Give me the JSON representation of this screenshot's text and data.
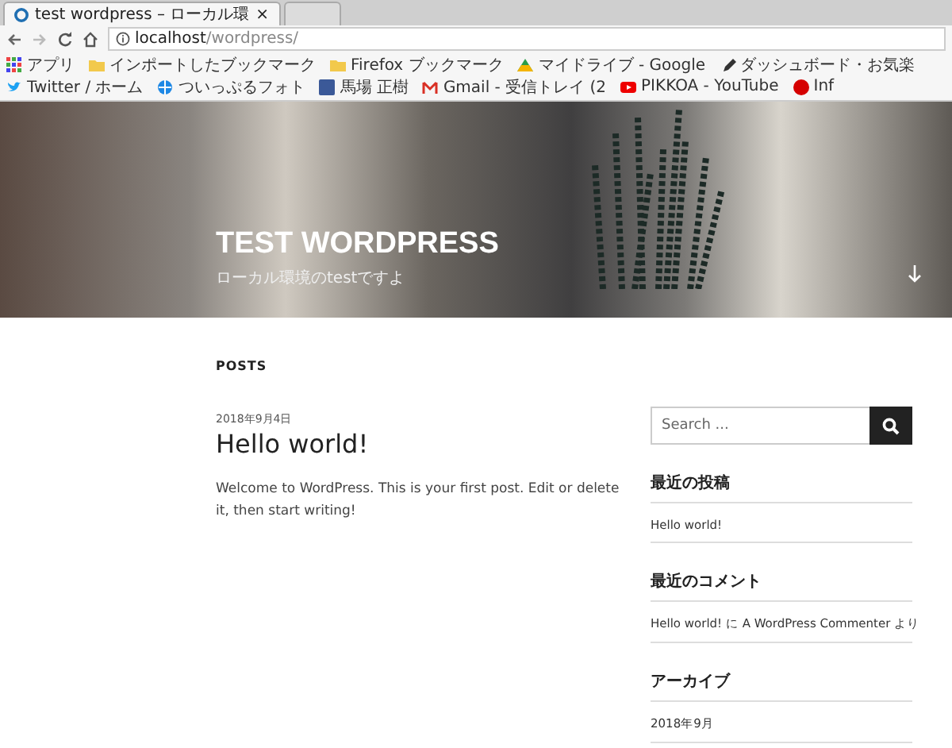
{
  "browser": {
    "tabs": [
      {
        "title": "test wordpress – ローカル環",
        "close": "×",
        "selected": true
      },
      {
        "selected": false
      }
    ],
    "address": {
      "host": "localhost",
      "path": "/wordpress/"
    },
    "bookmarks": [
      {
        "kind": "apps",
        "label": "アプリ"
      },
      {
        "kind": "folder",
        "label": "インポートしたブックマーク"
      },
      {
        "kind": "folder",
        "label": "Firefox ブックマーク"
      },
      {
        "kind": "drive",
        "label": "マイドライブ - Google"
      },
      {
        "kind": "pen",
        "label": "ダッシュボード・お気楽"
      },
      {
        "kind": "bird",
        "label": "Twitter / ホーム"
      },
      {
        "kind": "globe",
        "label": "ついっぷるフォト"
      },
      {
        "kind": "square",
        "label": "馬場 正樹"
      },
      {
        "kind": "mail",
        "label": "Gmail - 受信トレイ (2"
      },
      {
        "kind": "play",
        "label": "PIKKOA - YouTube"
      },
      {
        "kind": "circle",
        "label": "Inf"
      }
    ]
  },
  "header": {
    "title": "TEST WORDPRESS",
    "tagline": "ローカル環境のtestですよ"
  },
  "posts": {
    "heading": "POSTS",
    "items": [
      {
        "date": "2018年9月4日",
        "title": "Hello world!",
        "body": "Welcome to WordPress. This is your first post. Edit or delete it, then start writing!"
      }
    ]
  },
  "sidebar": {
    "search": {
      "placeholder": "Search ..."
    },
    "widgets": [
      {
        "heading": "最近の投稿",
        "items": [
          "Hello world!"
        ]
      },
      {
        "heading": "最近のコメント",
        "items": [
          "Hello world! に A WordPress Commenter より"
        ]
      },
      {
        "heading": "アーカイブ",
        "items": [
          "2018年9月"
        ]
      }
    ]
  }
}
